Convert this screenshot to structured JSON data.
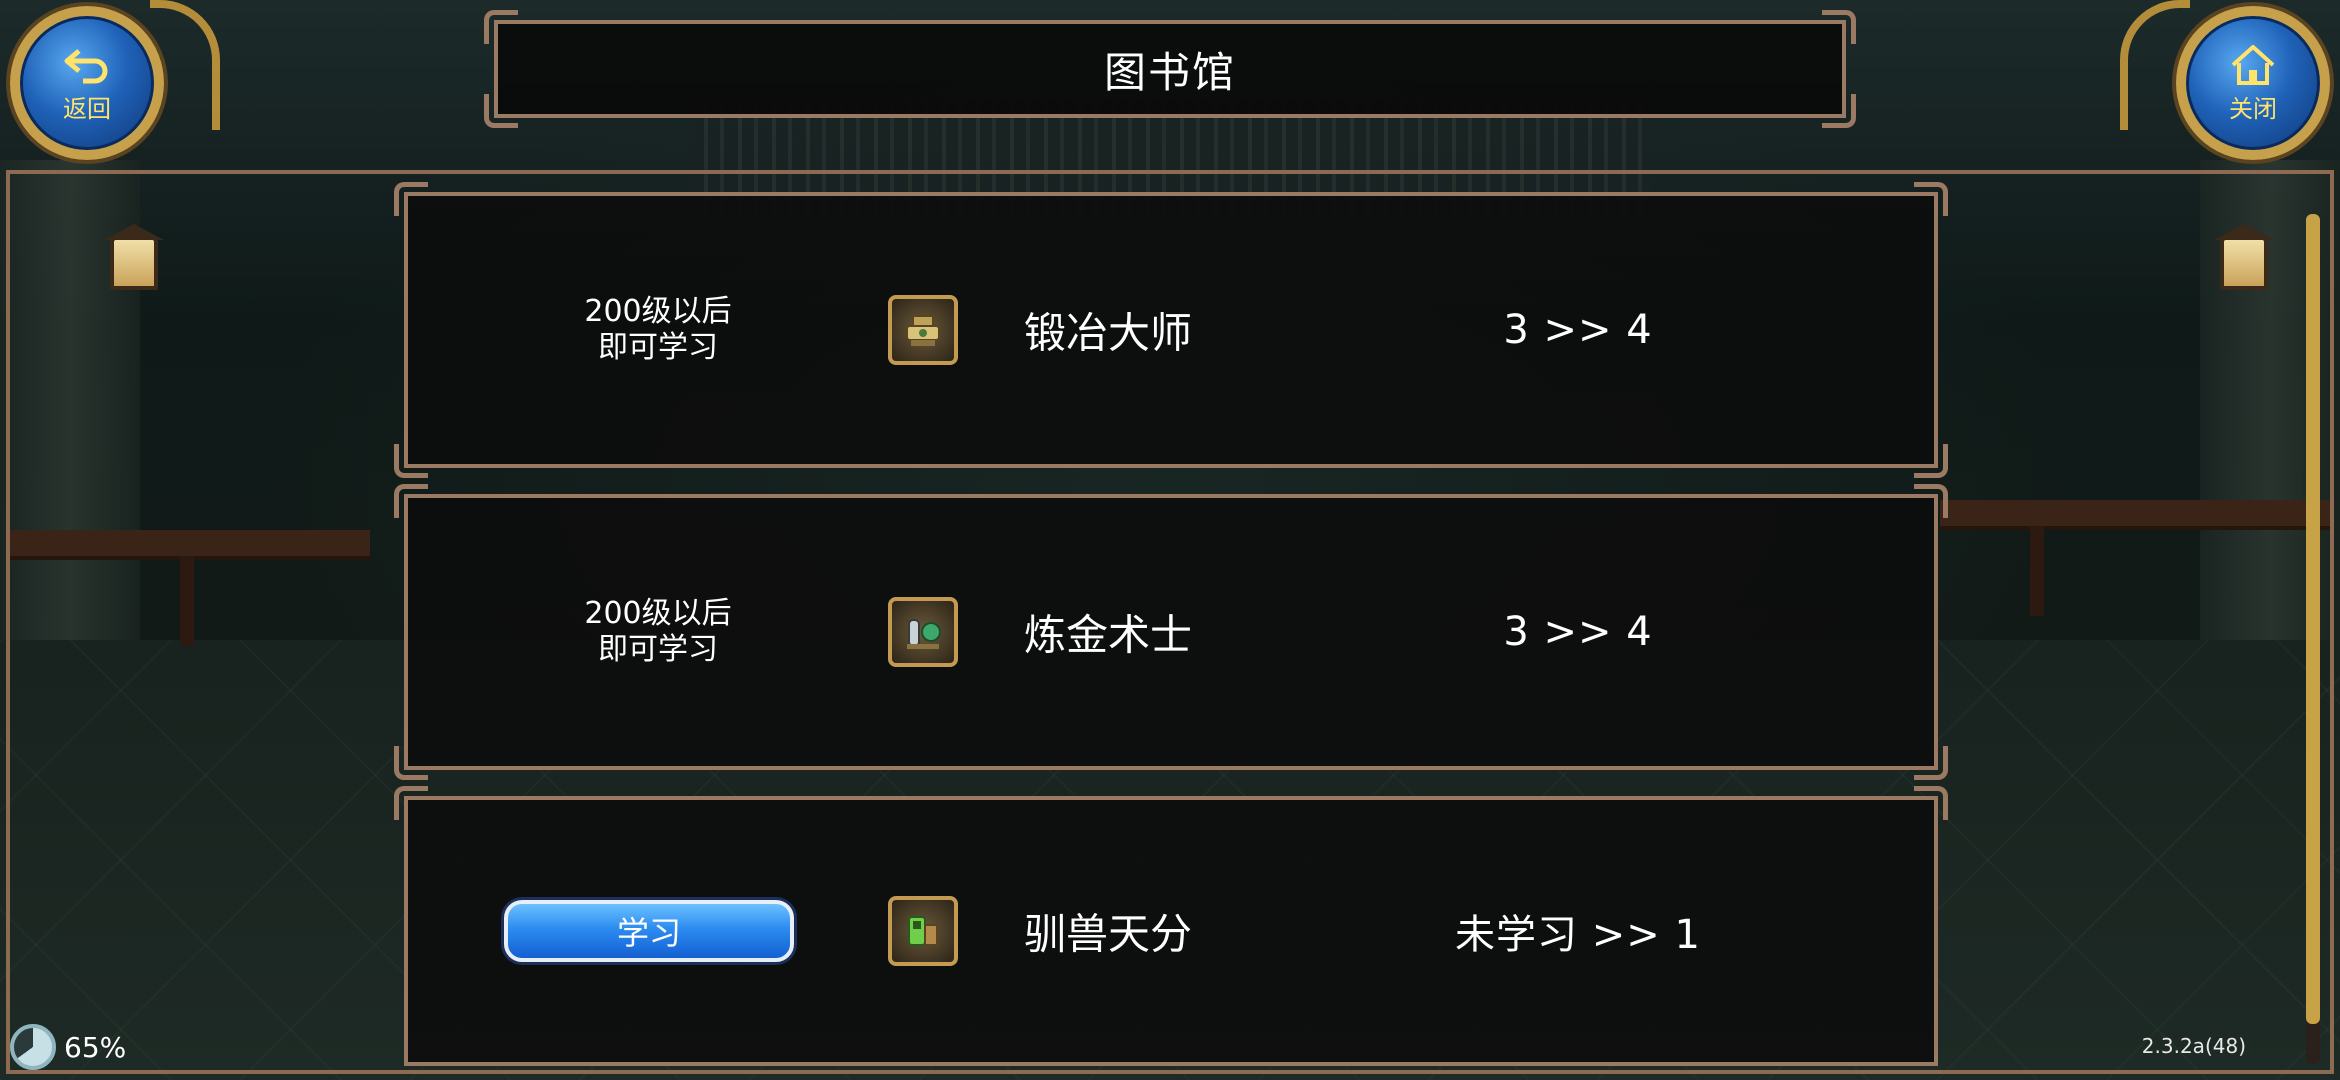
{
  "header": {
    "title": "图书馆",
    "back_label": "返回",
    "close_label": "关闭"
  },
  "skills": [
    {
      "requirement_line1": "200级以后",
      "requirement_line2": "即可学习",
      "name": "锻冶大师",
      "level": "3 >> 4",
      "icon": "forging-icon"
    },
    {
      "requirement_line1": "200级以后",
      "requirement_line2": "即可学习",
      "name": "炼金术士",
      "level": "3 >> 4",
      "icon": "alchemy-icon"
    },
    {
      "action_label": "学习",
      "name": "驯兽天分",
      "level": "未学习 >> 1",
      "icon": "taming-icon"
    }
  ],
  "status": {
    "battery": "65%",
    "battery_level": 0.65,
    "version": "2.3.2a(48)"
  },
  "colors": {
    "frame": "#9a7a62",
    "button_blue": "#2c8cf0",
    "label_yellow": "#ffe36a"
  }
}
